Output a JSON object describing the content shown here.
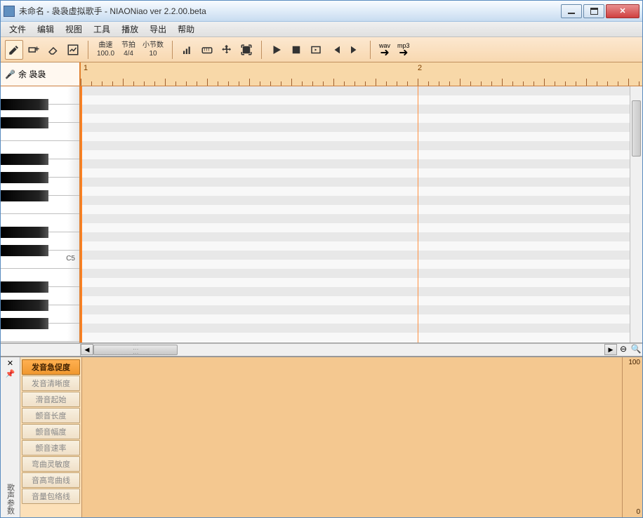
{
  "window": {
    "title": "未命名 - 袅袅虚拟歌手 - NIAONiao ver 2.2.00.beta"
  },
  "menu": {
    "items": [
      "文件",
      "编辑",
      "视图",
      "工具",
      "播放",
      "导出",
      "帮助"
    ]
  },
  "toolbar": {
    "tempo_label": "曲速",
    "tempo_value": "100.0",
    "beat_label": "节拍",
    "beat_value": "4/4",
    "measures_label": "小节数",
    "measures_value": "10",
    "export_wav": "wav",
    "export_mp3": "mp3"
  },
  "track": {
    "singer": "余 袅袅"
  },
  "ruler": {
    "marks": [
      "1",
      "2"
    ]
  },
  "piano": {
    "c_label": "C5"
  },
  "params": {
    "list": [
      "发音急促度",
      "发音清晰度",
      "滑音起始",
      "颤音长度",
      "颤音幅度",
      "颤音速率",
      "弯曲灵敏度",
      "音高弯曲线",
      "音量包络线"
    ],
    "active_index": 0,
    "scale_top": "100",
    "scale_bot": "0",
    "side_label": "歌声参数"
  }
}
